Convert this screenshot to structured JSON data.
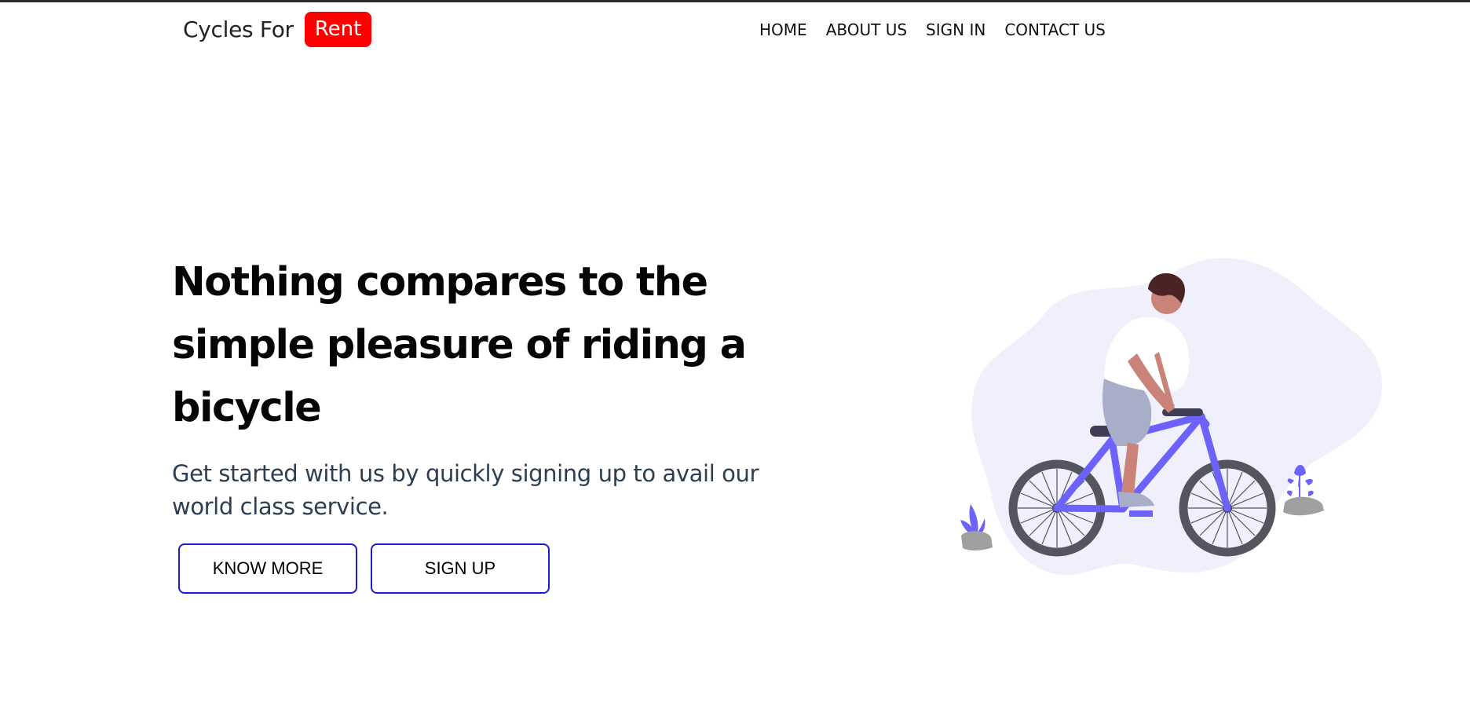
{
  "brand": {
    "name": "Cycles For",
    "badge": "Rent"
  },
  "nav": {
    "items": [
      "HOME",
      "ABOUT US",
      "SIGN IN",
      "CONTACT US"
    ]
  },
  "hero": {
    "title": "Nothing compares to the simple pleasure of riding a bicycle",
    "subtitle": "Get started with us by quickly signing up to avail our world class service.",
    "buttons": {
      "know_more": "KNOW MORE",
      "sign_up": "SIGN UP"
    }
  },
  "colors": {
    "badge": "#ff0000",
    "button_border": "#1a1ad6",
    "accent": "#6c63ff",
    "blob": "#f0effc"
  }
}
